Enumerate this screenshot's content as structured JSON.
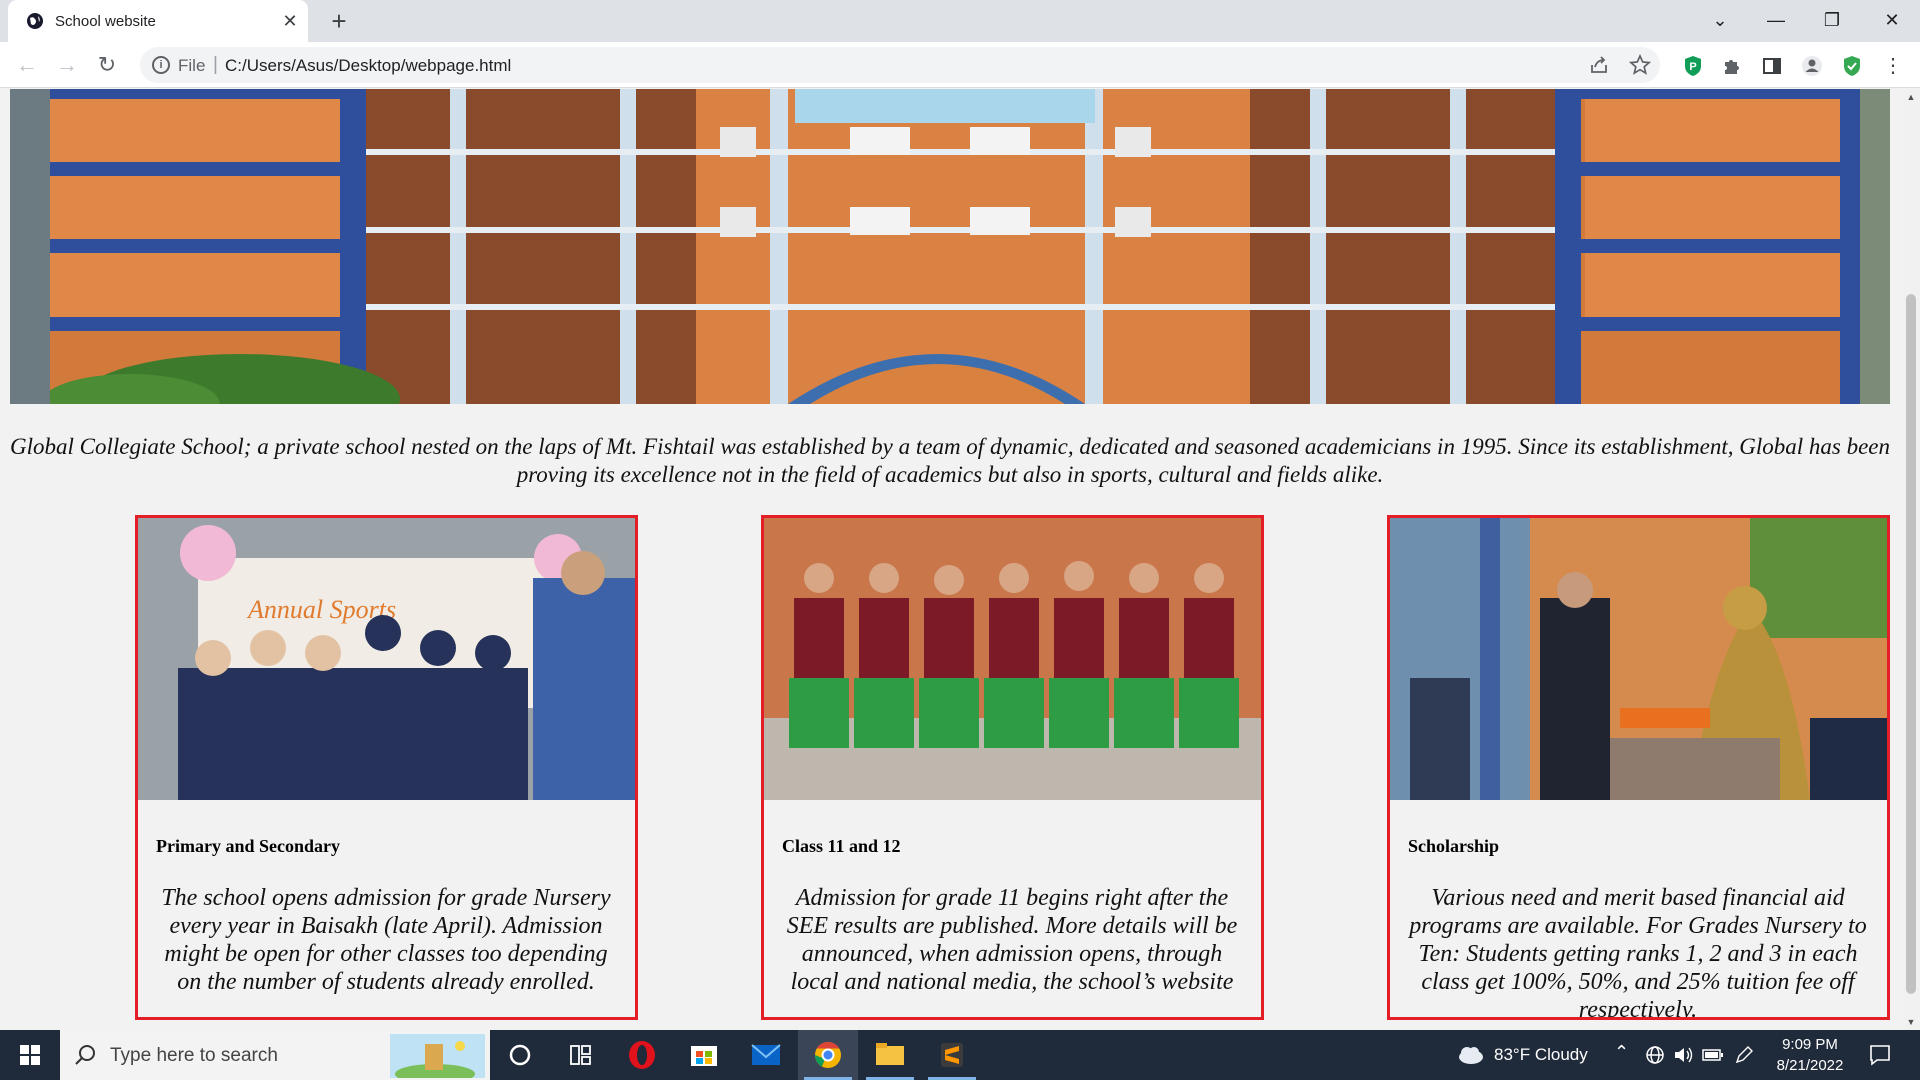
{
  "browser": {
    "tab_title": "School website",
    "tab_close": "✕",
    "new_tab": "+",
    "window_controls": {
      "minimize": "—",
      "restore": "❐",
      "close": "✕",
      "tab_search": "⌄"
    },
    "nav": {
      "back": "←",
      "forward": "→",
      "reload": "↻"
    },
    "address": {
      "info": "i",
      "scheme": "File",
      "separator": "|",
      "url": "C:/Users/Asus/Desktop/webpage.html"
    },
    "icons": [
      "share-icon",
      "bookmark-star-icon",
      "extension-p-icon",
      "extensions-puzzle-icon",
      "side-panel-icon",
      "profile-icon",
      "shield-check-icon",
      "menu-dots-icon"
    ]
  },
  "page": {
    "intro": "Global Collegiate School; a private school nested on the laps of Mt. Fishtail was established by a team of dynamic, dedicated and seasoned academicians in 1995. Since its establishment, Global has been proving its excellence not in the field of academics but also in sports, cultural and fields alike.",
    "cards": [
      {
        "title": "Primary and Secondary",
        "text": "The school opens admission for grade Nursery every year in Baisakh (late April). Admission might be open for other classes too depending on the number of students already enrolled."
      },
      {
        "title": "Class 11 and 12",
        "text": "Admission for grade 11 begins right after the SEE results are published. More details will be announced, when admission opens, through local and national media, the school’s website"
      },
      {
        "title": "Scholarship",
        "text": "Various need and merit based financial aid programs are available. For Grades Nursery to Ten: Students getting ranks 1, 2 and 3 in each class get 100%, 50%, and 25% tuition fee off respectively."
      }
    ],
    "colors": {
      "card_border": "#e41e26",
      "page_bg": "#f2f2f2",
      "building_orange": "#d87f3f",
      "building_blue": "#2f4f9c"
    }
  },
  "taskbar": {
    "search_placeholder": "Type here to search",
    "weather": "83°F  Cloudy",
    "time": "9:09 PM",
    "date": "8/21/2022",
    "apps": [
      "cortana-icon",
      "task-view-icon",
      "opera-icon",
      "microsoft-store-icon",
      "mail-icon",
      "chrome-icon",
      "file-explorer-icon",
      "sublime-text-icon"
    ]
  }
}
